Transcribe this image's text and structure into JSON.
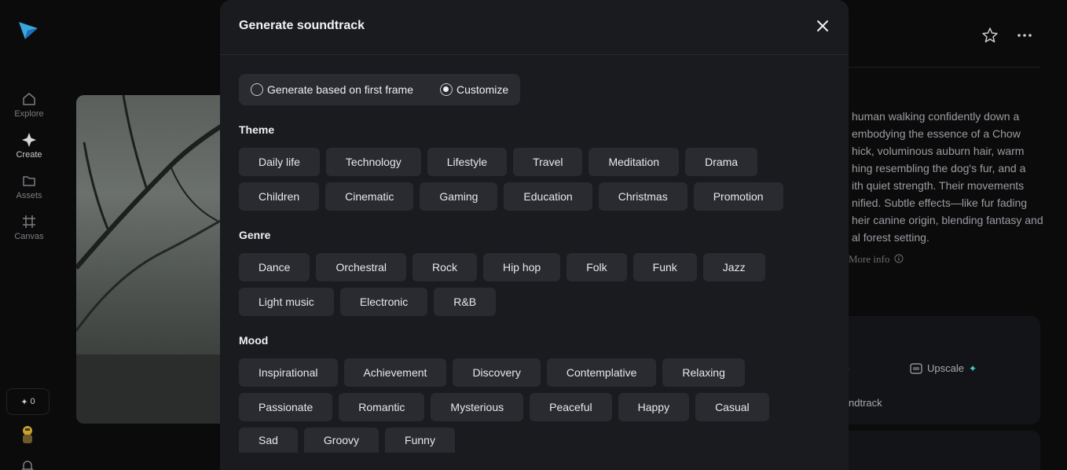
{
  "sidebar": {
    "items": [
      {
        "label": "Explore",
        "icon": "home-icon"
      },
      {
        "label": "Create",
        "icon": "sparkle-icon"
      },
      {
        "label": "Assets",
        "icon": "folder-icon"
      },
      {
        "label": "Canvas",
        "icon": "canvas-icon"
      }
    ],
    "credits": "0",
    "credits_symbol": "✦"
  },
  "background": {
    "description_lines": [
      "human walking confidently down a",
      "embodying the essence of a Chow",
      "hick, voluminous auburn hair, warm",
      "hing resembling the dog's fur, and a",
      "ith quiet strength. Their movements",
      "nified. Subtle effects—like fur fading",
      "heir canine origin, blending fantasy and",
      "al forest setting."
    ],
    "more_info": "More info",
    "upscale_label": "Upscale",
    "soundtrack_label": "ndtrack"
  },
  "modal": {
    "title": "Generate soundtrack",
    "mode_options": [
      {
        "label": "Generate based on first frame",
        "selected": false
      },
      {
        "label": "Customize",
        "selected": true
      }
    ],
    "theme": {
      "title": "Theme",
      "rows": [
        [
          "Daily life",
          "Technology",
          "Lifestyle",
          "Travel",
          "Meditation",
          "Drama"
        ],
        [
          "Children",
          "Cinematic",
          "Gaming",
          "Education",
          "Christmas",
          "Promotion"
        ]
      ]
    },
    "genre": {
      "title": "Genre",
      "rows": [
        [
          "Dance",
          "Orchestral",
          "Rock",
          "Hip hop",
          "Folk",
          "Funk",
          "Jazz"
        ],
        [
          "Light music",
          "Electronic",
          "R&B"
        ]
      ]
    },
    "mood": {
      "title": "Mood",
      "rows": [
        [
          "Inspirational",
          "Achievement",
          "Discovery",
          "Contemplative",
          "Relaxing"
        ],
        [
          "Passionate",
          "Romantic",
          "Mysterious",
          "Peaceful",
          "Happy",
          "Casual"
        ],
        [
          "Sad",
          "Groovy",
          "Funny"
        ]
      ]
    }
  },
  "colors": {
    "accent": "#3fd1c8",
    "modal_bg": "#1a1b1e",
    "chip_bg": "#2a2b30"
  }
}
